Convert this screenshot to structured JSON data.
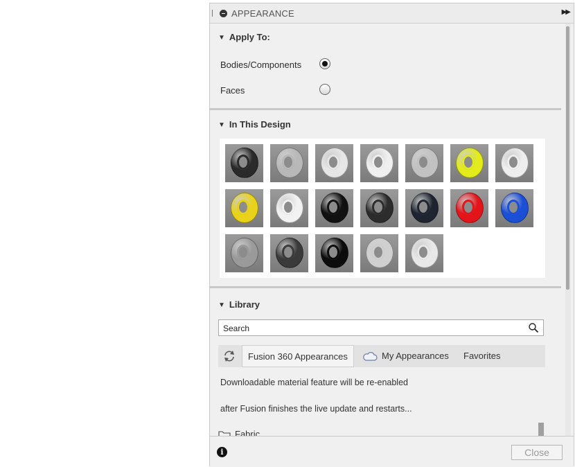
{
  "panel": {
    "title": "APPEARANCE"
  },
  "apply_to": {
    "header": "Apply To:",
    "options": [
      {
        "label": "Bodies/Components",
        "selected": true
      },
      {
        "label": "Faces",
        "selected": false
      }
    ]
  },
  "in_this_design": {
    "header": "In This Design",
    "swatches": [
      {
        "color": "#2a2a2a"
      },
      {
        "color": "#b8b8b8"
      },
      {
        "color": "#e6e6e6"
      },
      {
        "color": "#f0f0f0"
      },
      {
        "color": "#c2c2c2"
      },
      {
        "color": "#e3ec1a"
      },
      {
        "color": "#eeeeee"
      },
      {
        "color": "#e9d31a"
      },
      {
        "color": "#f2f2f2"
      },
      {
        "color": "#111111"
      },
      {
        "color": "#2c2c2c"
      },
      {
        "color": "#1e2430"
      },
      {
        "color": "#e3141a"
      },
      {
        "color": "#1a4fd6"
      },
      {
        "color": "#9a9a9a"
      },
      {
        "color": "#3a3a3a"
      },
      {
        "color": "#0c0c0c"
      },
      {
        "color": "#d0d0d0"
      },
      {
        "color": "#e8e8e8"
      }
    ]
  },
  "library": {
    "header": "Library",
    "search_placeholder": "Search",
    "tabs": [
      "Fusion 360 Appearances",
      "My Appearances",
      "Favorites"
    ],
    "messages": [
      "Downloadable material feature will be re-enabled",
      "after Fusion finishes the live update and restarts..."
    ],
    "folders": [
      "Fabric"
    ]
  },
  "footer": {
    "close_label": "Close"
  }
}
